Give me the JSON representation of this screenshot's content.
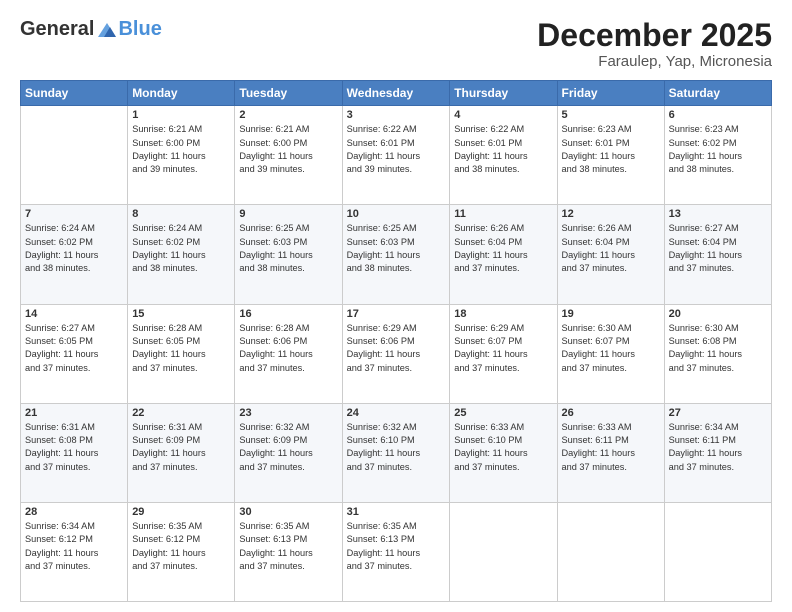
{
  "header": {
    "logo_general": "General",
    "logo_blue": "Blue",
    "month": "December 2025",
    "location": "Faraulep, Yap, Micronesia"
  },
  "days_of_week": [
    "Sunday",
    "Monday",
    "Tuesday",
    "Wednesday",
    "Thursday",
    "Friday",
    "Saturday"
  ],
  "weeks": [
    [
      {
        "day": "",
        "info": ""
      },
      {
        "day": "1",
        "info": "Sunrise: 6:21 AM\nSunset: 6:00 PM\nDaylight: 11 hours\nand 39 minutes."
      },
      {
        "day": "2",
        "info": "Sunrise: 6:21 AM\nSunset: 6:00 PM\nDaylight: 11 hours\nand 39 minutes."
      },
      {
        "day": "3",
        "info": "Sunrise: 6:22 AM\nSunset: 6:01 PM\nDaylight: 11 hours\nand 39 minutes."
      },
      {
        "day": "4",
        "info": "Sunrise: 6:22 AM\nSunset: 6:01 PM\nDaylight: 11 hours\nand 38 minutes."
      },
      {
        "day": "5",
        "info": "Sunrise: 6:23 AM\nSunset: 6:01 PM\nDaylight: 11 hours\nand 38 minutes."
      },
      {
        "day": "6",
        "info": "Sunrise: 6:23 AM\nSunset: 6:02 PM\nDaylight: 11 hours\nand 38 minutes."
      }
    ],
    [
      {
        "day": "7",
        "info": "Sunrise: 6:24 AM\nSunset: 6:02 PM\nDaylight: 11 hours\nand 38 minutes."
      },
      {
        "day": "8",
        "info": "Sunrise: 6:24 AM\nSunset: 6:02 PM\nDaylight: 11 hours\nand 38 minutes."
      },
      {
        "day": "9",
        "info": "Sunrise: 6:25 AM\nSunset: 6:03 PM\nDaylight: 11 hours\nand 38 minutes."
      },
      {
        "day": "10",
        "info": "Sunrise: 6:25 AM\nSunset: 6:03 PM\nDaylight: 11 hours\nand 38 minutes."
      },
      {
        "day": "11",
        "info": "Sunrise: 6:26 AM\nSunset: 6:04 PM\nDaylight: 11 hours\nand 37 minutes."
      },
      {
        "day": "12",
        "info": "Sunrise: 6:26 AM\nSunset: 6:04 PM\nDaylight: 11 hours\nand 37 minutes."
      },
      {
        "day": "13",
        "info": "Sunrise: 6:27 AM\nSunset: 6:04 PM\nDaylight: 11 hours\nand 37 minutes."
      }
    ],
    [
      {
        "day": "14",
        "info": "Sunrise: 6:27 AM\nSunset: 6:05 PM\nDaylight: 11 hours\nand 37 minutes."
      },
      {
        "day": "15",
        "info": "Sunrise: 6:28 AM\nSunset: 6:05 PM\nDaylight: 11 hours\nand 37 minutes."
      },
      {
        "day": "16",
        "info": "Sunrise: 6:28 AM\nSunset: 6:06 PM\nDaylight: 11 hours\nand 37 minutes."
      },
      {
        "day": "17",
        "info": "Sunrise: 6:29 AM\nSunset: 6:06 PM\nDaylight: 11 hours\nand 37 minutes."
      },
      {
        "day": "18",
        "info": "Sunrise: 6:29 AM\nSunset: 6:07 PM\nDaylight: 11 hours\nand 37 minutes."
      },
      {
        "day": "19",
        "info": "Sunrise: 6:30 AM\nSunset: 6:07 PM\nDaylight: 11 hours\nand 37 minutes."
      },
      {
        "day": "20",
        "info": "Sunrise: 6:30 AM\nSunset: 6:08 PM\nDaylight: 11 hours\nand 37 minutes."
      }
    ],
    [
      {
        "day": "21",
        "info": "Sunrise: 6:31 AM\nSunset: 6:08 PM\nDaylight: 11 hours\nand 37 minutes."
      },
      {
        "day": "22",
        "info": "Sunrise: 6:31 AM\nSunset: 6:09 PM\nDaylight: 11 hours\nand 37 minutes."
      },
      {
        "day": "23",
        "info": "Sunrise: 6:32 AM\nSunset: 6:09 PM\nDaylight: 11 hours\nand 37 minutes."
      },
      {
        "day": "24",
        "info": "Sunrise: 6:32 AM\nSunset: 6:10 PM\nDaylight: 11 hours\nand 37 minutes."
      },
      {
        "day": "25",
        "info": "Sunrise: 6:33 AM\nSunset: 6:10 PM\nDaylight: 11 hours\nand 37 minutes."
      },
      {
        "day": "26",
        "info": "Sunrise: 6:33 AM\nSunset: 6:11 PM\nDaylight: 11 hours\nand 37 minutes."
      },
      {
        "day": "27",
        "info": "Sunrise: 6:34 AM\nSunset: 6:11 PM\nDaylight: 11 hours\nand 37 minutes."
      }
    ],
    [
      {
        "day": "28",
        "info": "Sunrise: 6:34 AM\nSunset: 6:12 PM\nDaylight: 11 hours\nand 37 minutes."
      },
      {
        "day": "29",
        "info": "Sunrise: 6:35 AM\nSunset: 6:12 PM\nDaylight: 11 hours\nand 37 minutes."
      },
      {
        "day": "30",
        "info": "Sunrise: 6:35 AM\nSunset: 6:13 PM\nDaylight: 11 hours\nand 37 minutes."
      },
      {
        "day": "31",
        "info": "Sunrise: 6:35 AM\nSunset: 6:13 PM\nDaylight: 11 hours\nand 37 minutes."
      },
      {
        "day": "",
        "info": ""
      },
      {
        "day": "",
        "info": ""
      },
      {
        "day": "",
        "info": ""
      }
    ]
  ]
}
